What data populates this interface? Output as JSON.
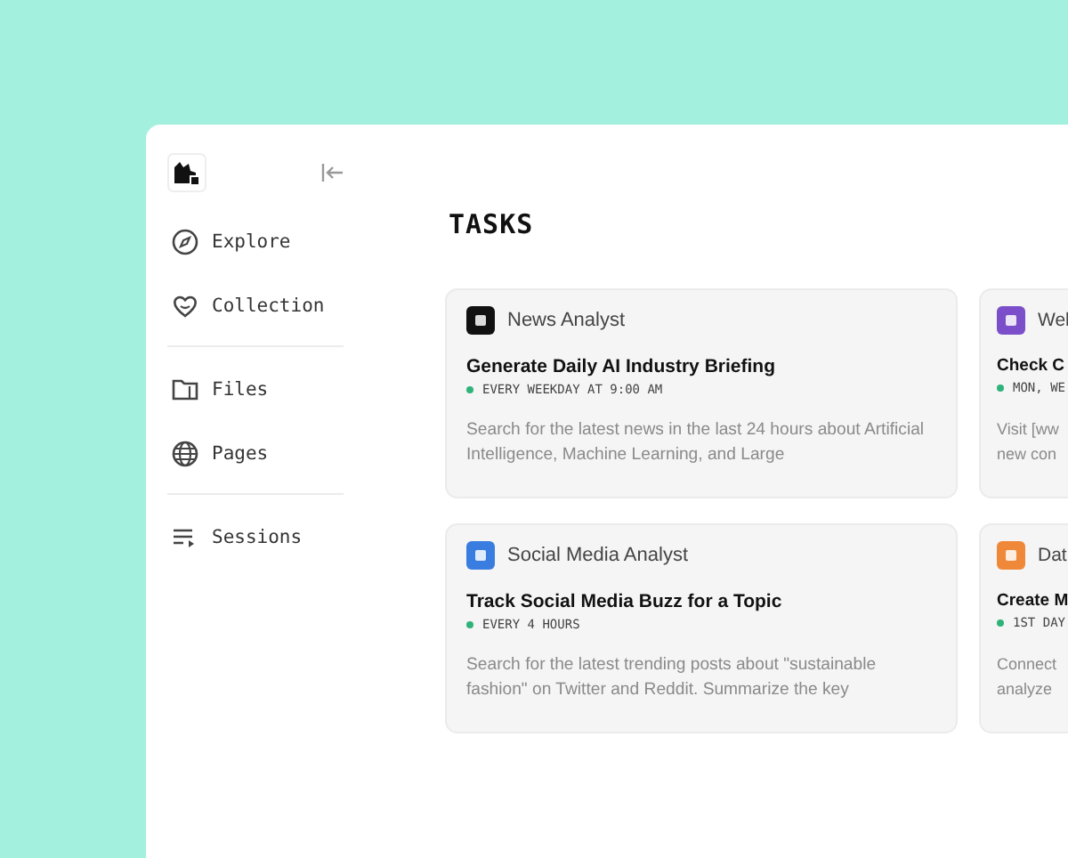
{
  "sidebar": {
    "items": [
      {
        "label": "Explore"
      },
      {
        "label": "Collection"
      },
      {
        "label": "Files"
      },
      {
        "label": "Pages"
      },
      {
        "label": "Sessions"
      }
    ]
  },
  "title": "TASKS",
  "tasks": [
    {
      "agent": "News Analyst",
      "color": "#111111",
      "title": "Generate Daily AI Industry Briefing",
      "schedule": "EVERY WEEKDAY AT 9:00 AM",
      "description": "Search for the latest news in the last 24 hours about Artificial Intelligence, Machine Learning, and Large"
    },
    {
      "agent": "Wel",
      "color": "#7b4fc9",
      "title": "Check C",
      "schedule": "MON, WE",
      "description": "Visit [ww new con"
    },
    {
      "agent": "Social Media Analyst",
      "color": "#3a7de0",
      "title": "Track Social Media Buzz for a Topic",
      "schedule": "EVERY 4 HOURS",
      "description": "Search for the latest trending posts about \"sustainable fashion\" on Twitter and Reddit. Summarize the key"
    },
    {
      "agent": "Dat",
      "color": "#f0883a",
      "title": "Create M",
      "schedule": "1ST DAY",
      "description": "Connect analyze"
    }
  ]
}
